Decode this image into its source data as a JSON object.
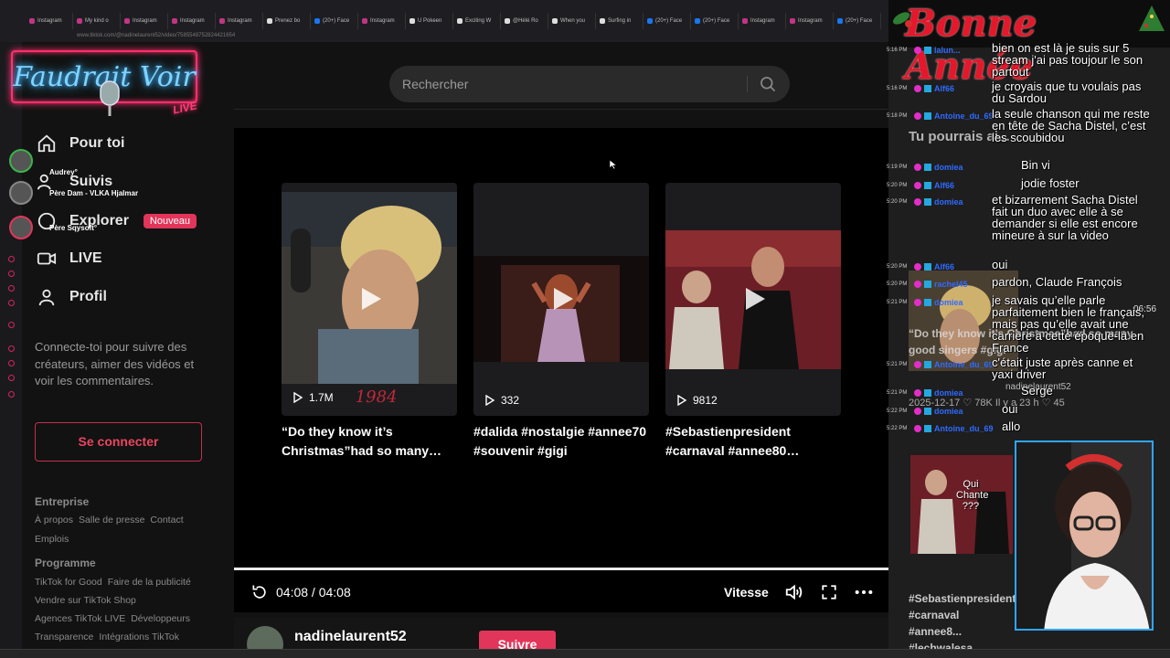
{
  "browser": {
    "tabs": [
      {
        "label": "Instagram",
        "kind": "ig"
      },
      {
        "label": "My kind o",
        "kind": "ig"
      },
      {
        "label": "Instagram",
        "kind": "ig"
      },
      {
        "label": "Instagram",
        "kind": "ig"
      },
      {
        "label": "Instagram",
        "kind": "ig"
      },
      {
        "label": "Prenez bo",
        "kind": "tt"
      },
      {
        "label": "(20+) Face",
        "kind": "fb"
      },
      {
        "label": "Instagram",
        "kind": "ig"
      },
      {
        "label": "U Pokeen",
        "kind": "tt"
      },
      {
        "label": "Exciting W",
        "kind": "tt"
      },
      {
        "label": "@Hélé Ro",
        "kind": "tt"
      },
      {
        "label": "When you",
        "kind": "tt"
      },
      {
        "label": "Surfing in",
        "kind": "tt"
      },
      {
        "label": "(20+) Face",
        "kind": "fb"
      },
      {
        "label": "(20+) Face",
        "kind": "fb"
      },
      {
        "label": "Instagram",
        "kind": "ig"
      },
      {
        "label": "Instagram",
        "kind": "ig"
      },
      {
        "label": "(20+) Face",
        "kind": "fb"
      }
    ],
    "url": "www.tiktok.com/@nadinelaurent52/video/7585548752824421654"
  },
  "overlay": {
    "logo_text": "Faudrait Voir",
    "logo_live": "LIVE",
    "viewers": [
      {
        "name": "Audrey°"
      },
      {
        "name": "Père Dam - VLKA Hjalmar"
      },
      {
        "name": "Père Sqysoft°"
      }
    ],
    "new_year": "Bonne Année"
  },
  "nav": {
    "items": [
      {
        "label": "Pour toi"
      },
      {
        "label": "Suivis"
      },
      {
        "label": "Explorer"
      },
      {
        "label": "LIVE"
      },
      {
        "label": "Profil"
      }
    ],
    "explorer_badge": "Nouveau",
    "connect_text": "Connecte-toi pour suivre des créateurs, aimer des vidéos et voir les commentaires.",
    "connect_button": "Se connecter",
    "footer": {
      "entreprise": "Entreprise",
      "entreprise_links": [
        "À propos",
        "Salle de presse",
        "Contact"
      ],
      "emplois": "Emplois",
      "programme": "Programme",
      "programme_links_1": [
        "TikTok for Good",
        "Faire de la publicité"
      ],
      "programme_links_2": [
        "Vendre sur TikTok Shop"
      ],
      "programme_links_3": [
        "Agences TikTok LIVE",
        "Développeurs"
      ],
      "programme_links_4": [
        "Transparence",
        "Intégrations TikTok"
      ]
    }
  },
  "search": {
    "placeholder": "Rechercher"
  },
  "player": {
    "cards": [
      {
        "views": "1.7M",
        "year": "1984",
        "caption": "“Do they know it’s Christmas”had so many…"
      },
      {
        "views": "332",
        "caption": "#dalida #nostalgie #annee70 #souvenir #gigi"
      },
      {
        "views": "9812",
        "caption": "#Sebastienpresident #carnaval #annee80…"
      }
    ],
    "progress": 1.0,
    "time": "04:08 / 04:08",
    "speed_label": "Vitesse"
  },
  "author": {
    "name": "nadinelaurent52",
    "follow": "Suivre"
  },
  "right": {
    "related_title": "Tu pourrais ai...",
    "rel_caption_1": "“Do they know it’s Christmas”had so many good singers #gigi",
    "rel_meta_1": "2025-12-17  ♡ 78K     Il y a 23 h  ♡ 45",
    "rel_caption_2": "#Sebastienpresident #carnaval #annee8... #lechwalesa...",
    "thumb_text": "Qui Chante ???",
    "rel_author": "nadinelaurent52",
    "duration": "06:56"
  },
  "chat": {
    "times": [
      "5:16 PM",
      "5:16 PM",
      "5:18 PM",
      "5:19 PM",
      "5:20 PM",
      "5:20 PM",
      "5:20 PM",
      "5:20 PM",
      "5:21 PM",
      "5:21 PM",
      "5:21 PM",
      "5:22 PM",
      "5:22 PM"
    ],
    "users": [
      "lalun...",
      "Alf66",
      "Antoine_du_69",
      "domiea",
      "Alf66",
      "domiea",
      "Alf66",
      "rachel45",
      "domiea",
      "Antoine_du_69",
      "domiea",
      "domiea",
      "Antoine_du_69"
    ],
    "messages": [
      "bien on est là je suis sur 5 stream j'ai pas toujour le son partout",
      "je croyais que tu voulais pas du Sardou",
      "la seule chanson qui me reste en tête de Sacha Distel, c’est les scoubidou",
      "Bin vi",
      "jodie foster",
      "et bizarrement Sacha Distel fait un duo avec elle à se demander si elle est encore mineure à sur la video",
      "oui",
      "pardon, Claude François",
      "je savais qu’elle parle parfaitement bien le français, mais pas qu’elle avait une carrière à cette époque-là en France",
      "c'était juste après canne et yaxi driver",
      "Serge",
      "oui",
      "allo"
    ]
  },
  "colors": {
    "accent": "#e2355a",
    "chat_user": "#2f6bff",
    "neon_pink": "#ff2f6d",
    "neon_blue": "#7fd3ff"
  }
}
